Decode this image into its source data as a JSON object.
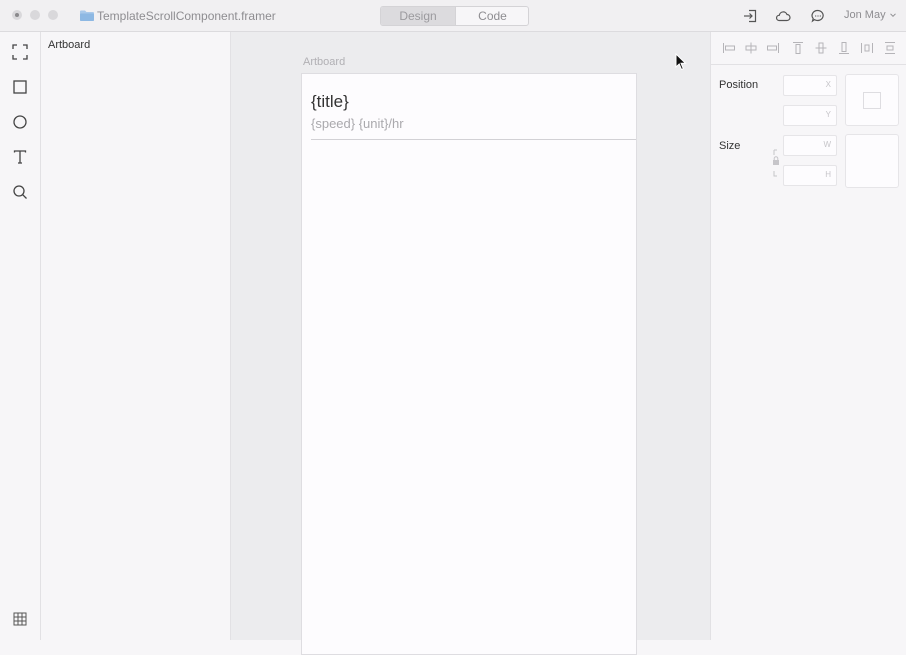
{
  "window": {
    "document_title": "TemplateScrollComponent.framer",
    "mode_tabs": [
      {
        "label": "Design",
        "selected": true
      },
      {
        "label": "Code",
        "selected": false
      }
    ],
    "user_name": "Jon May",
    "toolbar_icons": [
      "login-icon",
      "cloud-icon",
      "chat-icon"
    ]
  },
  "tools": [
    "frame-tool-icon",
    "rectangle-tool-icon",
    "oval-tool-icon",
    "text-tool-icon",
    "zoom-tool-icon",
    "grid-icon"
  ],
  "layers": {
    "items": [
      {
        "label": "Artboard"
      }
    ]
  },
  "canvas": {
    "artboard_label": "Artboard",
    "card_title": "{title}",
    "card_subtitle": "{speed} {unit}/hr"
  },
  "properties": {
    "position_label": "Position",
    "size_label": "Size",
    "x_label": "X",
    "y_label": "Y",
    "w_label": "W",
    "h_label": "H",
    "align_icons": [
      "align-left-icon",
      "align-center-h-icon",
      "align-right-icon",
      "align-top-icon",
      "align-center-v-icon",
      "align-bottom-icon",
      "distribute-h-icon",
      "distribute-v-icon"
    ]
  }
}
